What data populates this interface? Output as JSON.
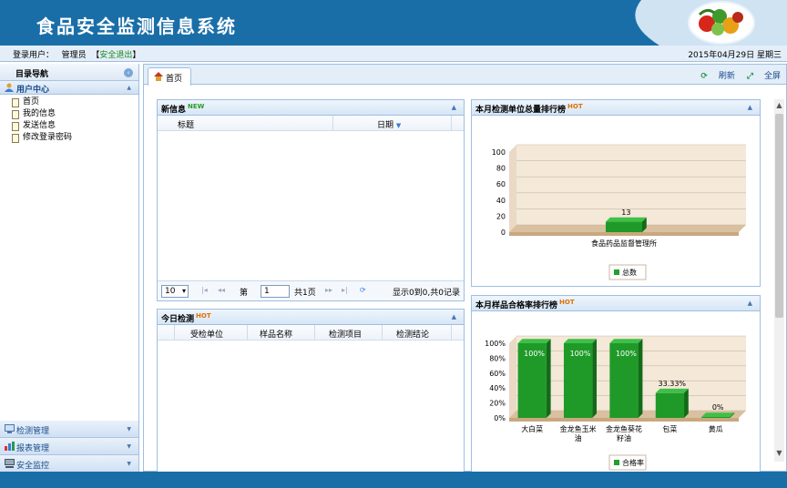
{
  "app": {
    "title": "食品安全监测信息系统"
  },
  "userbar": {
    "login_label": "登录用户：",
    "username": "管理员",
    "logout_open": "【",
    "logout": "安全退出",
    "logout_close": "】",
    "date": "2015年04月29日 星期三"
  },
  "sidebar": {
    "nav_title": "目录导航",
    "user_center": "用户中心",
    "items": [
      {
        "label": "首页"
      },
      {
        "label": "我的信息"
      },
      {
        "label": "发送信息"
      },
      {
        "label": "修改登录密码"
      }
    ],
    "groups": [
      {
        "label": "检测管理",
        "icon": "monitor-icon"
      },
      {
        "label": "报表管理",
        "icon": "bar-chart-icon"
      },
      {
        "label": "安全监控",
        "icon": "computer-icon"
      }
    ]
  },
  "tabs": {
    "home": "首页",
    "refresh": "刷新",
    "fullscreen": "全屏"
  },
  "news": {
    "title": "新信息",
    "badge": "NEW",
    "columns": [
      "标题",
      "日期"
    ],
    "pager": {
      "page_size": "10",
      "page_prefix": "第",
      "page_value": "1",
      "page_total": "共1页",
      "info": "显示0到0,共0记录"
    }
  },
  "today": {
    "title": "今日检测",
    "badge": "HOT",
    "columns": [
      "受检单位",
      "样品名称",
      "检测项目",
      "检测结论"
    ]
  },
  "chart1_panel": {
    "title": "本月检测单位总量排行榜",
    "badge": "HOT"
  },
  "chart2_panel": {
    "title": "本月样品合格率排行榜",
    "badge": "HOT"
  },
  "chart_data": [
    {
      "type": "bar",
      "categories": [
        "食品药品监督管理所"
      ],
      "series": [
        {
          "name": "总数",
          "values": [
            13
          ]
        }
      ],
      "data_labels": [
        "13"
      ],
      "ylim": [
        0,
        100
      ],
      "yticks": [
        "0",
        "20",
        "40",
        "60",
        "80",
        "100"
      ],
      "color": "#22a02a",
      "legend": "bottom"
    },
    {
      "type": "bar",
      "categories": [
        "大白菜",
        "金龙鱼玉米油",
        "金龙鱼葵花籽油",
        "包菜",
        "黄瓜"
      ],
      "series": [
        {
          "name": "合格率",
          "values": [
            100,
            100,
            100,
            33.33,
            0
          ]
        }
      ],
      "data_labels": [
        "100%",
        "100%",
        "100%",
        "33.33%",
        "0%"
      ],
      "ylim": [
        0,
        100
      ],
      "yticks": [
        "0%",
        "20%",
        "40%",
        "60%",
        "80%",
        "100%"
      ],
      "color": "#22a02a",
      "legend": "bottom"
    }
  ]
}
